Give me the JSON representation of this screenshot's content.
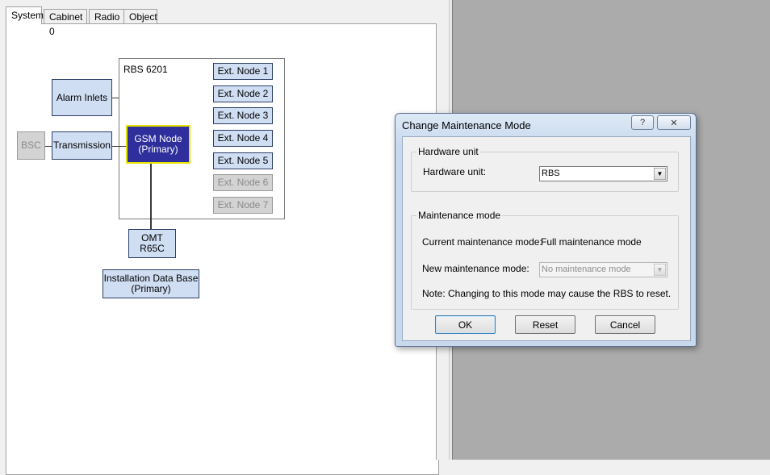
{
  "tabs": [
    {
      "label": "System",
      "active": true
    },
    {
      "label": "Cabinet 0"
    },
    {
      "label": "Radio"
    },
    {
      "label": "Object"
    }
  ],
  "diagram": {
    "rbs_title": "RBS 6201",
    "alarm_inlets": "Alarm Inlets",
    "transmission": "Transmission",
    "bsc": "BSC",
    "gsm_node_line1": "GSM Node",
    "gsm_node_line2": "(Primary)",
    "omt_line1": "OMT",
    "omt_line2": "R65C",
    "idb_line1": "Installation Data Base",
    "idb_line2": "(Primary)",
    "ext_nodes": [
      {
        "label": "Ext. Node 1",
        "enabled": true
      },
      {
        "label": "Ext. Node 2",
        "enabled": true
      },
      {
        "label": "Ext. Node 3",
        "enabled": true
      },
      {
        "label": "Ext. Node 4",
        "enabled": true
      },
      {
        "label": "Ext. Node 5",
        "enabled": true
      },
      {
        "label": "Ext. Node 6",
        "enabled": false
      },
      {
        "label": "Ext. Node 7",
        "enabled": false
      }
    ]
  },
  "dialog": {
    "title": "Change Maintenance Mode",
    "help_glyph": "?",
    "close_glyph": "✕",
    "hardware_group_label": "Hardware unit",
    "hardware_unit_label": "Hardware unit:",
    "hardware_unit_value": "RBS",
    "maintenance_group_label": "Maintenance mode",
    "current_mode_label": "Current maintenance mode:",
    "current_mode_value": "Full maintenance mode",
    "new_mode_label": "New maintenance mode:",
    "new_mode_value": "No maintenance mode",
    "note": "Note: Changing to this mode may cause the RBS to reset.",
    "ok_label": "OK",
    "reset_label": "Reset",
    "cancel_label": "Cancel",
    "dropdown_arrow": "▼"
  },
  "colors": {
    "node_fill": "#d0def3",
    "gsm_fill": "#2e2e9c",
    "gsm_border": "#e8e200",
    "workspace": "#ababab"
  }
}
